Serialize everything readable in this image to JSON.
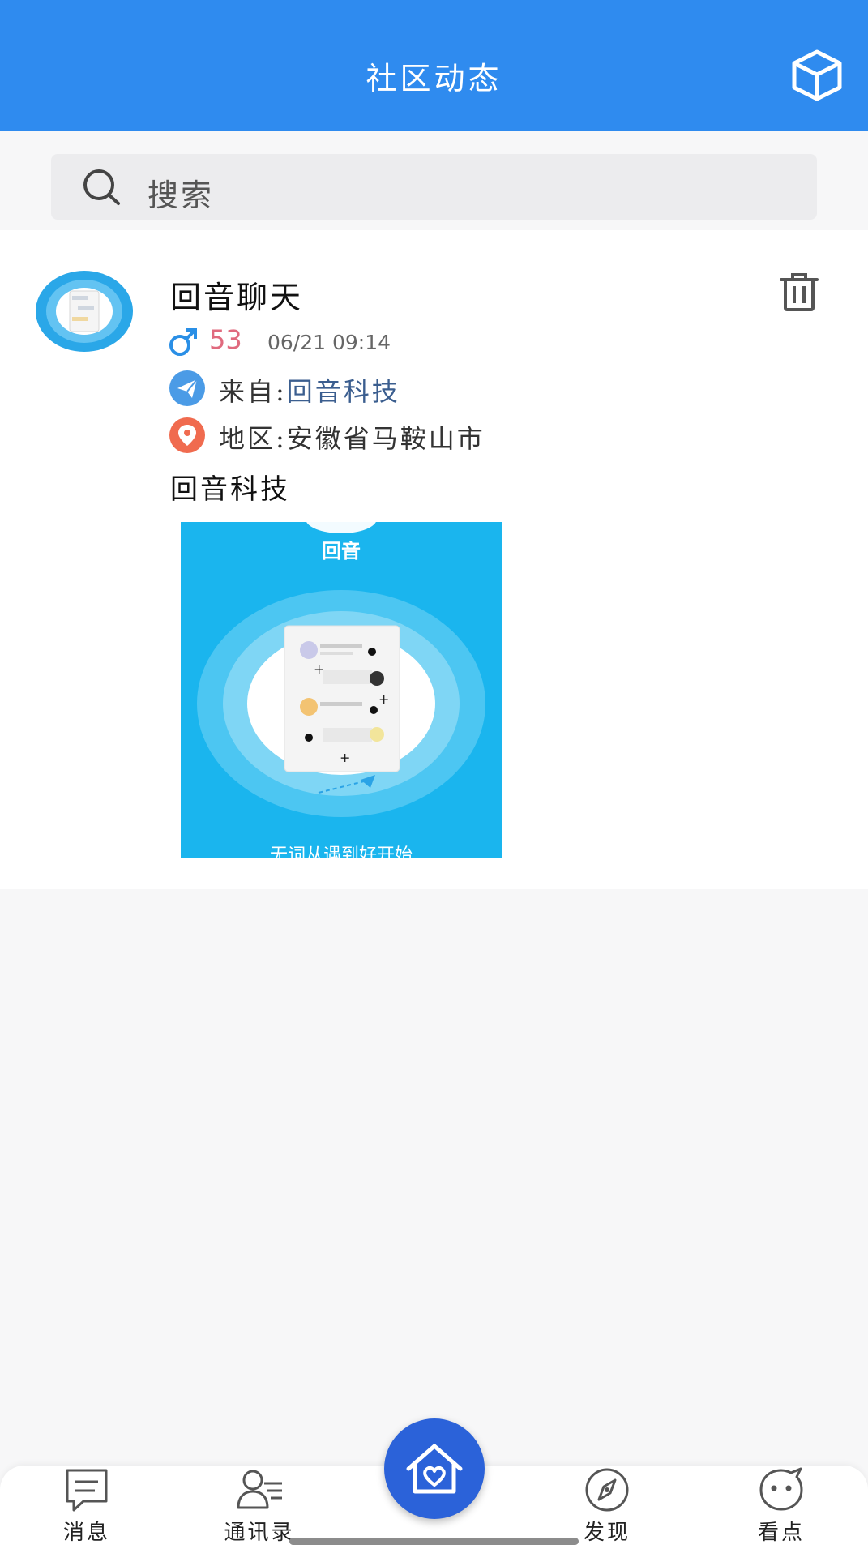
{
  "header": {
    "title": "社区动态"
  },
  "search": {
    "placeholder": "搜索"
  },
  "post": {
    "author": "回音聊天",
    "age": "53",
    "time": "06/21 09:14",
    "from_label": "来自:",
    "from_value": "回音科技",
    "location_label": "地区:",
    "location_value": "安徽省马鞍山市",
    "content": "回音科技",
    "image": {
      "logo_text": "回音",
      "caption": "无词从遇到好开始"
    }
  },
  "tabbar": {
    "tabs": [
      {
        "label": "消息",
        "icon": "message-icon"
      },
      {
        "label": "通讯录",
        "icon": "contacts-icon"
      },
      {
        "label": "",
        "icon": "home-heart-icon"
      },
      {
        "label": "发现",
        "icon": "compass-icon"
      },
      {
        "label": "看点",
        "icon": "face-icon"
      }
    ]
  },
  "colors": {
    "header_bg": "#2f8bef",
    "accent_pink": "#e06a7e",
    "link_blue": "#3b5e8f",
    "center_button": "#2b62d9"
  }
}
